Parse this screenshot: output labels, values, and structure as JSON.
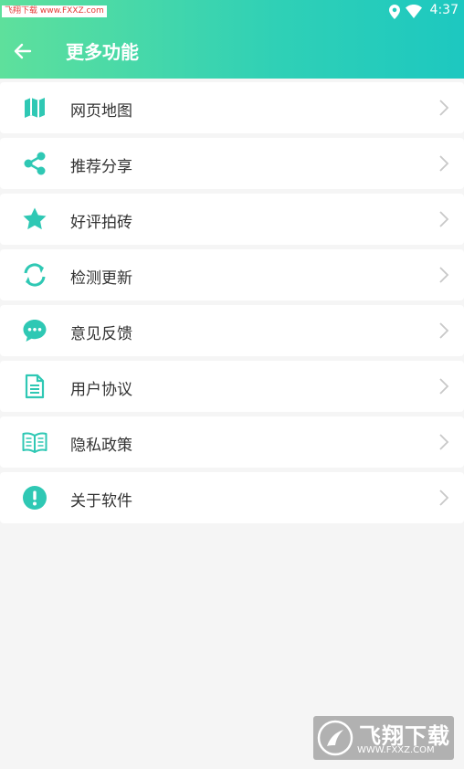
{
  "status_bar": {
    "watermark": "飞翔下载 www.FXXZ.com",
    "time": "4:37"
  },
  "toolbar": {
    "title": "更多功能"
  },
  "colors": {
    "accent": "#2fc8b4",
    "header_gradient": [
      "#5ee09c",
      "#1dc8c0"
    ]
  },
  "menu": [
    {
      "label": "网页地图",
      "icon": "map-icon"
    },
    {
      "label": "推荐分享",
      "icon": "share-icon"
    },
    {
      "label": "好评拍砖",
      "icon": "star-icon"
    },
    {
      "label": "检测更新",
      "icon": "refresh-icon"
    },
    {
      "label": "意见反馈",
      "icon": "chat-icon"
    },
    {
      "label": "用户协议",
      "icon": "document-icon"
    },
    {
      "label": "隐私政策",
      "icon": "book-icon"
    },
    {
      "label": "关于软件",
      "icon": "info-icon"
    }
  ],
  "watermark_bottom": {
    "title": "飞翔下载",
    "url": "WWW.FXXZ.COM"
  }
}
